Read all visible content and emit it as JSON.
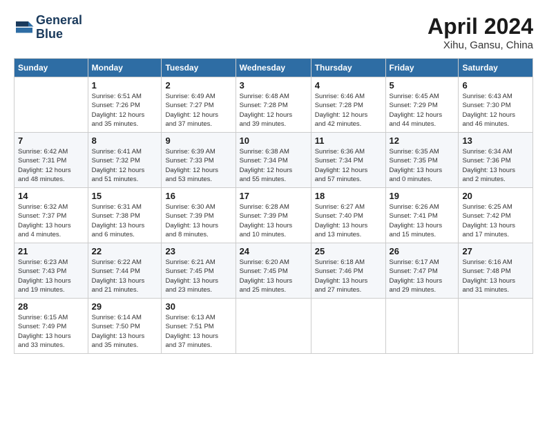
{
  "logo": {
    "line1": "General",
    "line2": "Blue"
  },
  "title": "April 2024",
  "location": "Xihu, Gansu, China",
  "headers": [
    "Sunday",
    "Monday",
    "Tuesday",
    "Wednesday",
    "Thursday",
    "Friday",
    "Saturday"
  ],
  "weeks": [
    [
      {
        "day": "",
        "info": ""
      },
      {
        "day": "1",
        "info": "Sunrise: 6:51 AM\nSunset: 7:26 PM\nDaylight: 12 hours\nand 35 minutes."
      },
      {
        "day": "2",
        "info": "Sunrise: 6:49 AM\nSunset: 7:27 PM\nDaylight: 12 hours\nand 37 minutes."
      },
      {
        "day": "3",
        "info": "Sunrise: 6:48 AM\nSunset: 7:28 PM\nDaylight: 12 hours\nand 39 minutes."
      },
      {
        "day": "4",
        "info": "Sunrise: 6:46 AM\nSunset: 7:28 PM\nDaylight: 12 hours\nand 42 minutes."
      },
      {
        "day": "5",
        "info": "Sunrise: 6:45 AM\nSunset: 7:29 PM\nDaylight: 12 hours\nand 44 minutes."
      },
      {
        "day": "6",
        "info": "Sunrise: 6:43 AM\nSunset: 7:30 PM\nDaylight: 12 hours\nand 46 minutes."
      }
    ],
    [
      {
        "day": "7",
        "info": "Sunrise: 6:42 AM\nSunset: 7:31 PM\nDaylight: 12 hours\nand 48 minutes."
      },
      {
        "day": "8",
        "info": "Sunrise: 6:41 AM\nSunset: 7:32 PM\nDaylight: 12 hours\nand 51 minutes."
      },
      {
        "day": "9",
        "info": "Sunrise: 6:39 AM\nSunset: 7:33 PM\nDaylight: 12 hours\nand 53 minutes."
      },
      {
        "day": "10",
        "info": "Sunrise: 6:38 AM\nSunset: 7:34 PM\nDaylight: 12 hours\nand 55 minutes."
      },
      {
        "day": "11",
        "info": "Sunrise: 6:36 AM\nSunset: 7:34 PM\nDaylight: 12 hours\nand 57 minutes."
      },
      {
        "day": "12",
        "info": "Sunrise: 6:35 AM\nSunset: 7:35 PM\nDaylight: 13 hours\nand 0 minutes."
      },
      {
        "day": "13",
        "info": "Sunrise: 6:34 AM\nSunset: 7:36 PM\nDaylight: 13 hours\nand 2 minutes."
      }
    ],
    [
      {
        "day": "14",
        "info": "Sunrise: 6:32 AM\nSunset: 7:37 PM\nDaylight: 13 hours\nand 4 minutes."
      },
      {
        "day": "15",
        "info": "Sunrise: 6:31 AM\nSunset: 7:38 PM\nDaylight: 13 hours\nand 6 minutes."
      },
      {
        "day": "16",
        "info": "Sunrise: 6:30 AM\nSunset: 7:39 PM\nDaylight: 13 hours\nand 8 minutes."
      },
      {
        "day": "17",
        "info": "Sunrise: 6:28 AM\nSunset: 7:39 PM\nDaylight: 13 hours\nand 10 minutes."
      },
      {
        "day": "18",
        "info": "Sunrise: 6:27 AM\nSunset: 7:40 PM\nDaylight: 13 hours\nand 13 minutes."
      },
      {
        "day": "19",
        "info": "Sunrise: 6:26 AM\nSunset: 7:41 PM\nDaylight: 13 hours\nand 15 minutes."
      },
      {
        "day": "20",
        "info": "Sunrise: 6:25 AM\nSunset: 7:42 PM\nDaylight: 13 hours\nand 17 minutes."
      }
    ],
    [
      {
        "day": "21",
        "info": "Sunrise: 6:23 AM\nSunset: 7:43 PM\nDaylight: 13 hours\nand 19 minutes."
      },
      {
        "day": "22",
        "info": "Sunrise: 6:22 AM\nSunset: 7:44 PM\nDaylight: 13 hours\nand 21 minutes."
      },
      {
        "day": "23",
        "info": "Sunrise: 6:21 AM\nSunset: 7:45 PM\nDaylight: 13 hours\nand 23 minutes."
      },
      {
        "day": "24",
        "info": "Sunrise: 6:20 AM\nSunset: 7:45 PM\nDaylight: 13 hours\nand 25 minutes."
      },
      {
        "day": "25",
        "info": "Sunrise: 6:18 AM\nSunset: 7:46 PM\nDaylight: 13 hours\nand 27 minutes."
      },
      {
        "day": "26",
        "info": "Sunrise: 6:17 AM\nSunset: 7:47 PM\nDaylight: 13 hours\nand 29 minutes."
      },
      {
        "day": "27",
        "info": "Sunrise: 6:16 AM\nSunset: 7:48 PM\nDaylight: 13 hours\nand 31 minutes."
      }
    ],
    [
      {
        "day": "28",
        "info": "Sunrise: 6:15 AM\nSunset: 7:49 PM\nDaylight: 13 hours\nand 33 minutes."
      },
      {
        "day": "29",
        "info": "Sunrise: 6:14 AM\nSunset: 7:50 PM\nDaylight: 13 hours\nand 35 minutes."
      },
      {
        "day": "30",
        "info": "Sunrise: 6:13 AM\nSunset: 7:51 PM\nDaylight: 13 hours\nand 37 minutes."
      },
      {
        "day": "",
        "info": ""
      },
      {
        "day": "",
        "info": ""
      },
      {
        "day": "",
        "info": ""
      },
      {
        "day": "",
        "info": ""
      }
    ]
  ]
}
